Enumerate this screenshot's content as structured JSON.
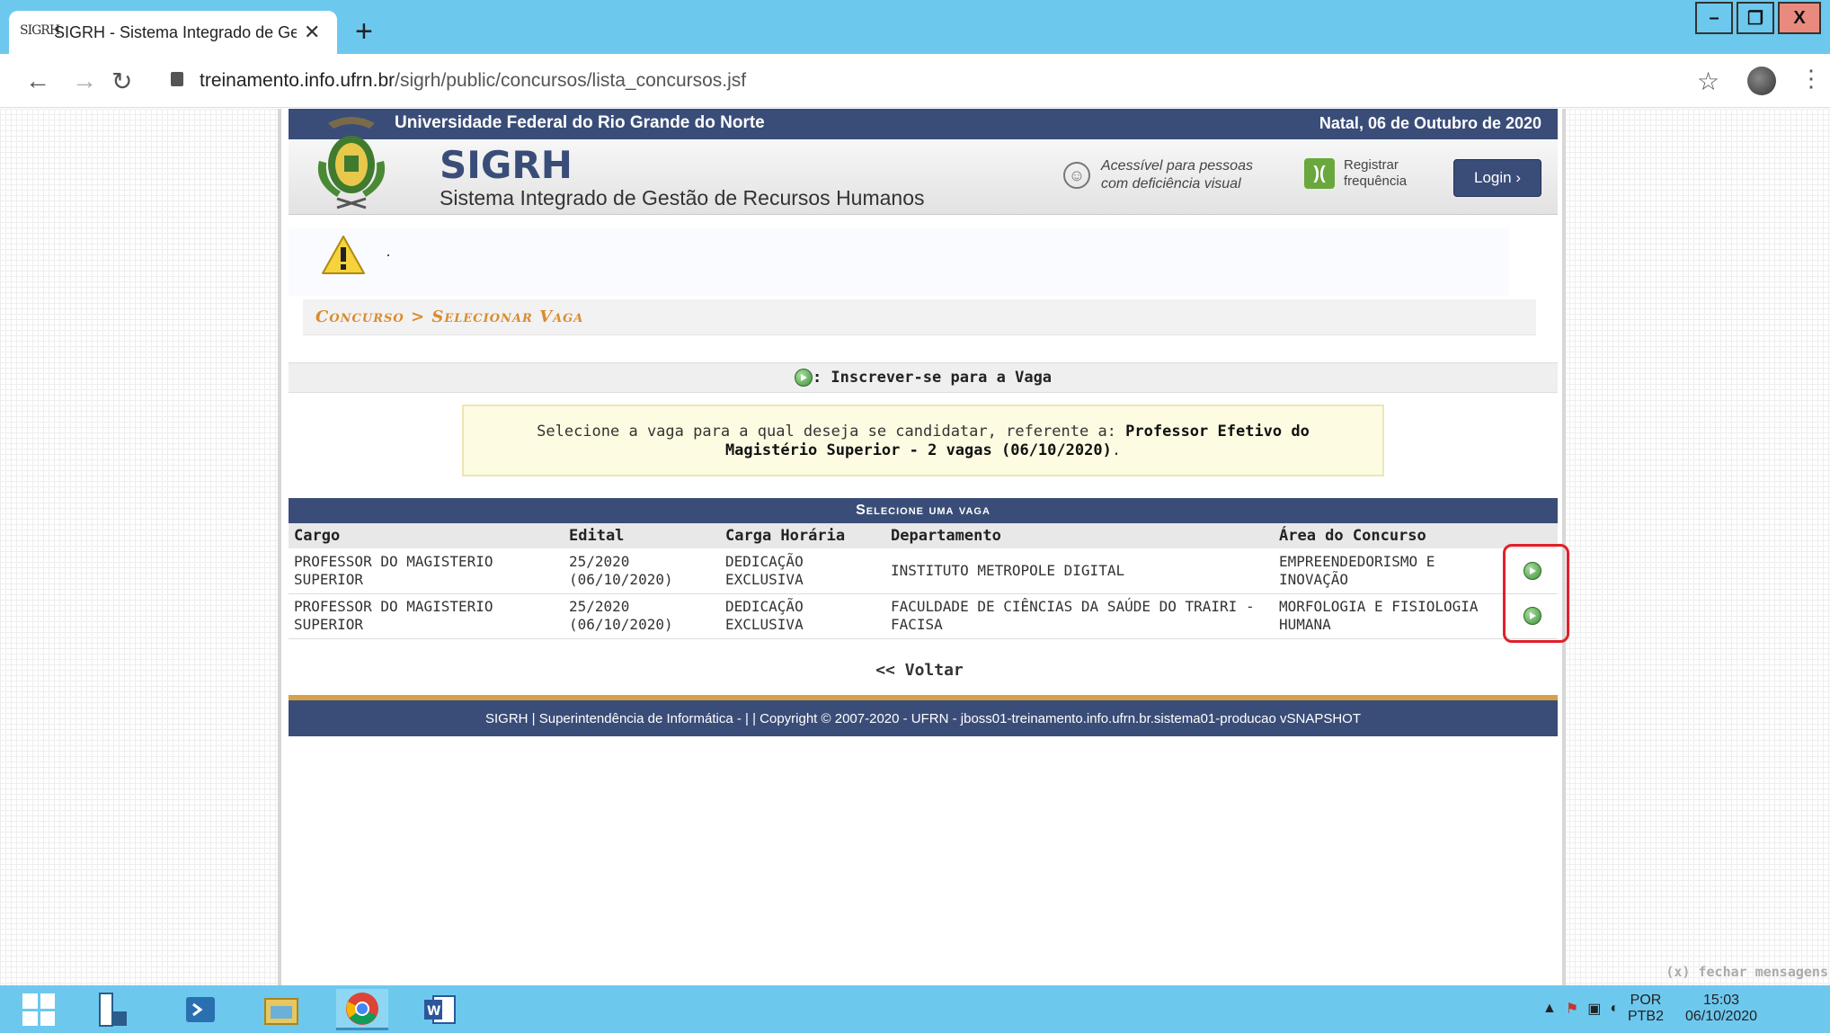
{
  "browser": {
    "tab_title": "SIGRH - Sistema Integrado de Ge",
    "tab_favicon": "SIGRH",
    "url_domain": "treinamento.info.ufrn.br",
    "url_path": "/sigrh/public/concursos/lista_concursos.jsf"
  },
  "header": {
    "university": "Universidade Federal do Rio Grande do Norte",
    "date": "Natal, 06 de Outubro de 2020",
    "system_short": "SIGRH",
    "system_full": "Sistema Integrado de Gestão de Recursos Humanos",
    "accessibility": "Acessível para pessoas com deficiência visual",
    "register": "Registrar frequência",
    "login": "Login  ›"
  },
  "warning": {
    "text": "·"
  },
  "breadcrumb": "Concurso > Selecionar Vaga",
  "legend": ": Inscrever-se para a Vaga",
  "info": {
    "prefix": "Selecione a vaga para a qual deseja se candidatar, referente a: ",
    "bold": "Professor Efetivo do Magistério Superior - 2 vagas (06/10/2020)",
    "suffix": "."
  },
  "table": {
    "caption": "Selecione uma vaga",
    "headers": [
      "Cargo",
      "Edital",
      "Carga Horária",
      "Departamento",
      "Área do Concurso"
    ],
    "rows": [
      {
        "cargo": "PROFESSOR DO MAGISTERIO SUPERIOR",
        "edital": "25/2020 (06/10/2020)",
        "carga": "DEDICAÇÃO EXCLUSIVA",
        "departamento": "INSTITUTO METROPOLE DIGITAL",
        "area": "EMPREENDEDORISMO E INOVAÇÃO"
      },
      {
        "cargo": "PROFESSOR DO MAGISTERIO SUPERIOR",
        "edital": "25/2020 (06/10/2020)",
        "carga": "DEDICAÇÃO EXCLUSIVA",
        "departamento": "FACULDADE DE CIÊNCIAS DA SAÚDE DO TRAIRI - FACISA",
        "area": "MORFOLOGIA E FISIOLOGIA HUMANA"
      }
    ]
  },
  "voltar": "<< Voltar",
  "footer": "SIGRH | Superintendência de Informática - | | Copyright © 2007-2020 - UFRN - jboss01-treinamento.info.ufrn.br.sistema01-producao vSNAPSHOT",
  "fechar": "(x) fechar mensagens",
  "taskbar": {
    "lang_top": "POR",
    "lang_bottom": "PTB2",
    "time": "15:03",
    "date": "06/10/2020"
  },
  "colors": {
    "accent": "#3a4d78",
    "breadcrumb": "#d98c2c",
    "highlight": "#e0202a",
    "chrome": "#6dc8ee"
  }
}
